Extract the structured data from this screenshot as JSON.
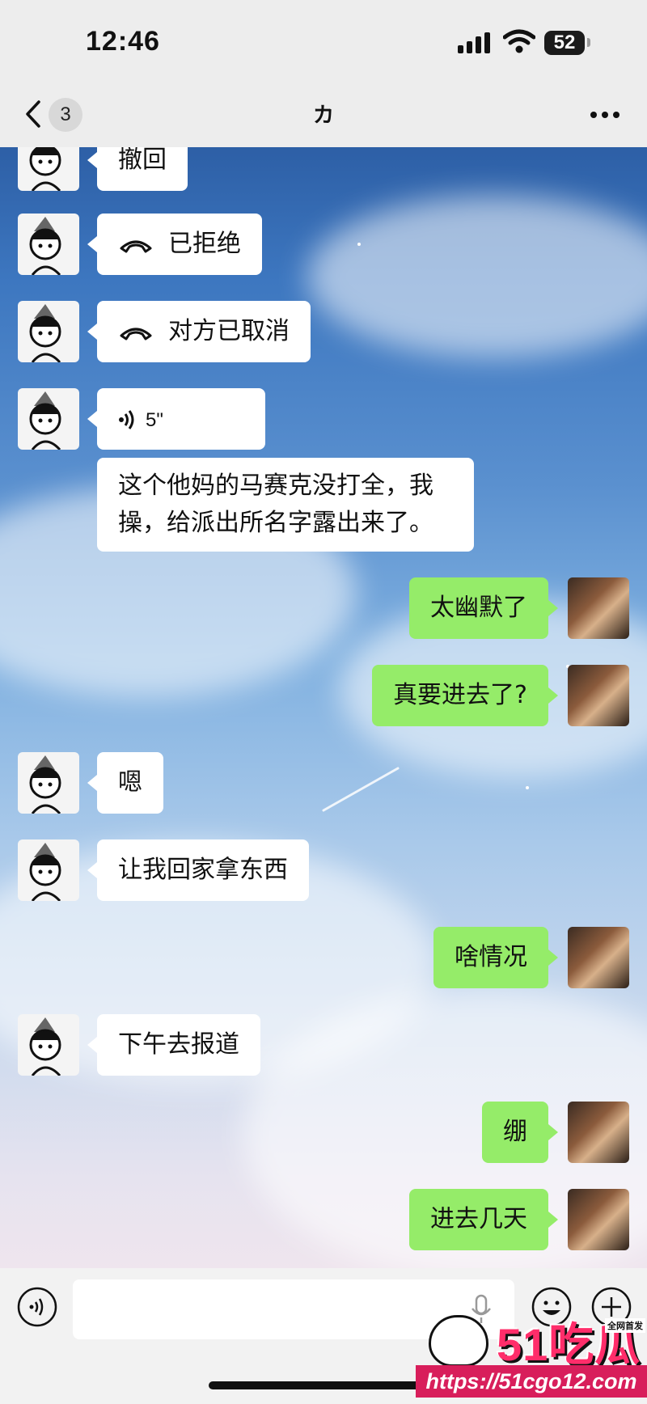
{
  "status_bar": {
    "time": "12:46",
    "battery": "52"
  },
  "nav": {
    "unread_count": "3",
    "title": "カ"
  },
  "messages": [
    {
      "side": "left",
      "type": "text",
      "text": "撤回"
    },
    {
      "side": "left",
      "type": "call",
      "text": "已拒绝"
    },
    {
      "side": "left",
      "type": "call",
      "text": "对方已取消"
    },
    {
      "side": "left",
      "type": "voice",
      "text": "5\""
    },
    {
      "side": "left",
      "type": "text",
      "text": "这个他妈的马赛克没打全，我操，给派出所名字露出来了。"
    },
    {
      "side": "right",
      "type": "text",
      "text": "太幽默了"
    },
    {
      "side": "right",
      "type": "text",
      "text": "真要进去了?"
    },
    {
      "side": "left",
      "type": "text",
      "text": "嗯"
    },
    {
      "side": "left",
      "type": "text",
      "text": "让我回家拿东西"
    },
    {
      "side": "right",
      "type": "text",
      "text": "啥情况"
    },
    {
      "side": "left",
      "type": "text",
      "text": "下午去报道"
    },
    {
      "side": "right",
      "type": "text",
      "text": "绷"
    },
    {
      "side": "right",
      "type": "text",
      "text": "进去几天"
    }
  ],
  "input": {
    "value": ""
  },
  "watermark": {
    "logo": "51吃瓜",
    "tag": "全网首发",
    "url": "https://51cgo12.com"
  },
  "colors": {
    "outgoing_bubble": "#95ec69",
    "incoming_bubble": "#ffffff",
    "bar_bg": "#ededed"
  }
}
